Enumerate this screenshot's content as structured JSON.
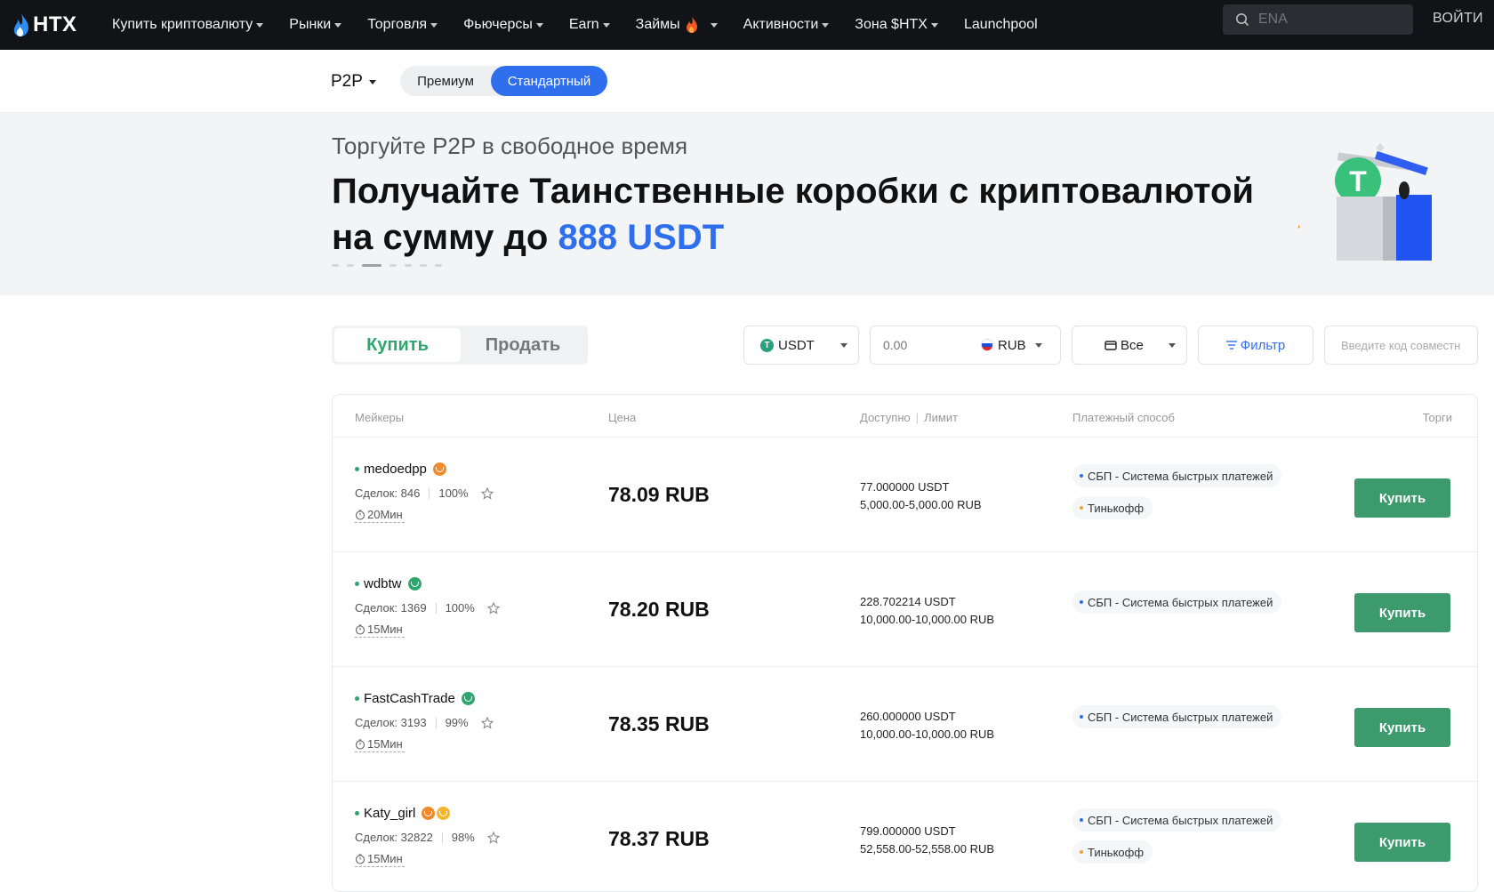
{
  "brand": {
    "name": "HTX"
  },
  "nav": {
    "items": [
      {
        "label": "Купить криптовалюту",
        "dropdown": true
      },
      {
        "label": "Рынки",
        "dropdown": true
      },
      {
        "label": "Торговля",
        "dropdown": true
      },
      {
        "label": "Фьючерсы",
        "dropdown": true
      },
      {
        "label": "Earn",
        "dropdown": true
      },
      {
        "label": "Займы",
        "dropdown": true,
        "icon": "fire-icon"
      },
      {
        "label": "Активности",
        "dropdown": true
      },
      {
        "label": "Зона $HTX",
        "dropdown": true
      },
      {
        "label": "Launchpool",
        "dropdown": false
      }
    ],
    "search_placeholder": "ENA",
    "login_label": "ВОЙТИ"
  },
  "subheader": {
    "p2p_label": "P2P",
    "tabs": [
      "Премиум",
      "Стандартный"
    ],
    "active_tab": "Стандартный"
  },
  "banner": {
    "subtitle": "Торгуйте P2P в свободное время",
    "title_line1": "Получайте Таинственные коробки с криптовалютой",
    "title_line2_prefix": "на сумму до ",
    "title_line2_accent": "888 USDT",
    "slide_count": 7,
    "active_slide": 2
  },
  "controls": {
    "buy_label": "Купить",
    "sell_label": "Продать",
    "coin": "USDT",
    "amount_placeholder": "0.00",
    "fiat": "RUB",
    "payment": "Все",
    "filter_label": "Фильтр",
    "code_placeholder": "Введите код совместн"
  },
  "table": {
    "headers": {
      "makers": "Мейкеры",
      "price": "Цена",
      "available": "Доступно",
      "limit": "Лимит",
      "payment": "Платежный способ",
      "trade": "Торги"
    },
    "rows": [
      {
        "name": "medoedpp",
        "deals": "Сделок: 846",
        "rate": "100%",
        "time": "20Мин",
        "price": "78.09 RUB",
        "available": "77.000000 USDT",
        "limit": "5,000.00-5,000.00 RUB",
        "payments": [
          "СБП - Система быстрых платежей",
          "Тинькофф"
        ],
        "button": "Купить"
      },
      {
        "name": "wdbtw",
        "deals": "Сделок: 1369",
        "rate": "100%",
        "time": "15Мин",
        "price": "78.20 RUB",
        "available": "228.702214 USDT",
        "limit": "10,000.00-10,000.00 RUB",
        "payments": [
          "СБП - Система быстрых платежей"
        ],
        "button": "Купить"
      },
      {
        "name": "FastCashTrade",
        "deals": "Сделок: 3193",
        "rate": "99%",
        "time": "15Мин",
        "price": "78.35 RUB",
        "available": "260.000000 USDT",
        "limit": "10,000.00-10,000.00 RUB",
        "payments": [
          "СБП - Система быстрых платежей"
        ],
        "button": "Купить"
      },
      {
        "name": "Katy_girl",
        "deals": "Сделок: 32822",
        "rate": "98%",
        "time": "15Мин",
        "price": "78.37 RUB",
        "available": "799.000000 USDT",
        "limit": "52,558.00-52,558.00 RUB",
        "payments": [
          "СБП - Система быстрых платежей",
          "Тинькофф"
        ],
        "button": "Купить"
      }
    ]
  },
  "colors": {
    "nav_bg": "#121316",
    "accent_blue": "#2f6fed",
    "buy_green": "#3d9a6c",
    "online_green": "#2ea66d"
  }
}
